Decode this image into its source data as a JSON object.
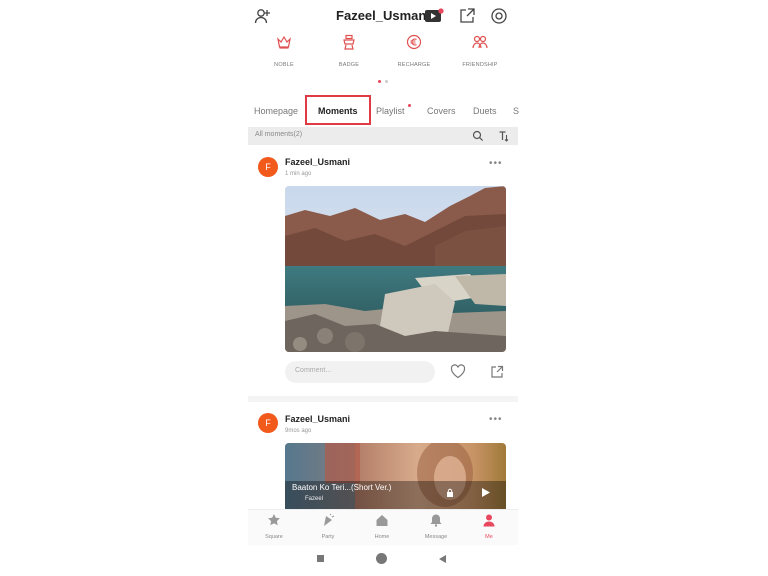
{
  "header": {
    "title": "Fazeel_Usmani"
  },
  "quick_links": [
    {
      "label": "NOBLE",
      "icon": "crown-icon"
    },
    {
      "label": "BADGE",
      "icon": "badge-icon"
    },
    {
      "label": "RECHARGE",
      "icon": "coin-icon"
    },
    {
      "label": "FRIENDSHIP",
      "icon": "friendship-icon"
    }
  ],
  "tabs": [
    {
      "label": "Homepage"
    },
    {
      "label": "Moments"
    },
    {
      "label": "Playlist"
    },
    {
      "label": "Covers"
    },
    {
      "label": "Duets"
    },
    {
      "label": "S"
    }
  ],
  "filter": {
    "label": "All moments(2)"
  },
  "posts": [
    {
      "user": "Fazeel_Usmani",
      "avatar_letter": "F",
      "time": "1 min ago",
      "comment_placeholder": "Comment..."
    },
    {
      "user": "Fazeel_Usmani",
      "avatar_letter": "F",
      "time": "9mos ago",
      "video_title": "Baaton Ko Teri...(Short Ver.)",
      "video_subtitle": "Fazeel"
    }
  ],
  "bottom_nav": [
    {
      "label": "Square"
    },
    {
      "label": "Party"
    },
    {
      "label": "Home"
    },
    {
      "label": "Message"
    },
    {
      "label": "Me"
    }
  ],
  "colors": {
    "accent": "#e8475e",
    "highlight_border": "#e03a45",
    "avatar": "#f25a1b",
    "quick_link": "#e05050"
  }
}
